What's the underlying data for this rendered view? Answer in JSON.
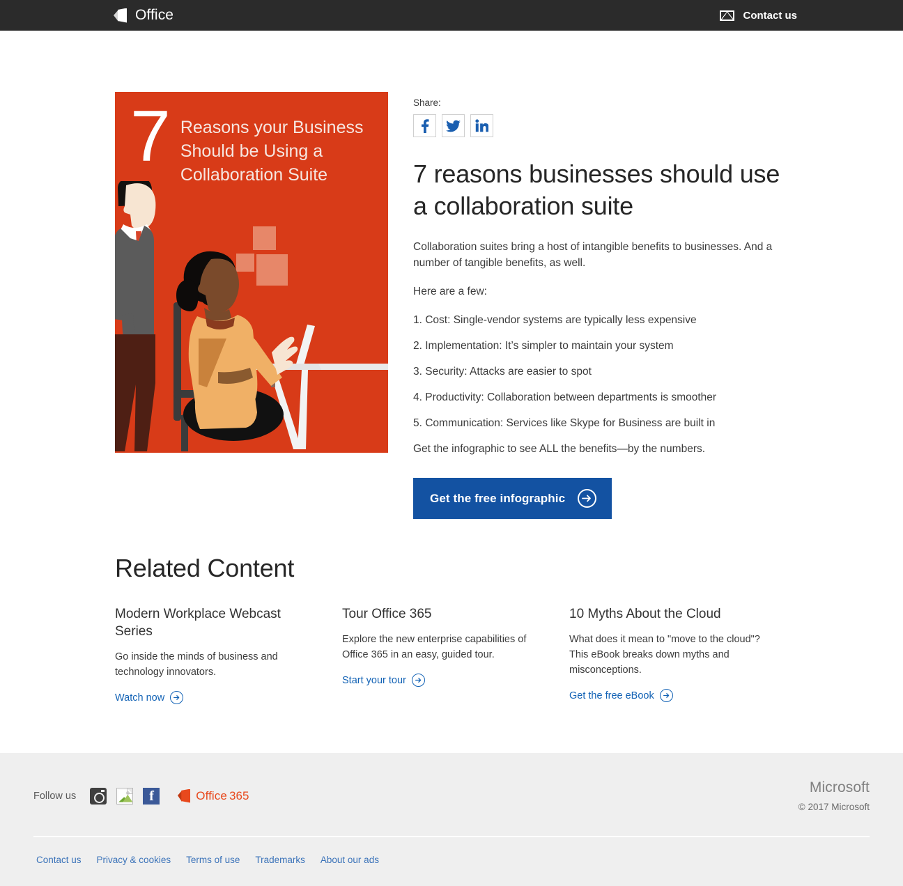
{
  "topnav": {
    "brand": "Office",
    "brand_icon": "office-logo-icon",
    "contact_label": "Contact us",
    "contact_icon": "envelope-icon",
    "background": "#2b2b2b"
  },
  "cover": {
    "number": "7",
    "lines": [
      "Reasons your Business",
      "Should be Using a",
      "Collaboration Suite"
    ],
    "background": "#d83b18",
    "illustration": "two-coworkers-at-desk-illustration"
  },
  "share": {
    "label": "Share:",
    "buttons": [
      {
        "name": "facebook",
        "glyph": "f",
        "color": "#1b5fb0"
      },
      {
        "name": "twitter",
        "glyph": "bird",
        "color": "#1b5fb0"
      },
      {
        "name": "linkedin",
        "glyph": "in",
        "color": "#1b5fb0"
      }
    ]
  },
  "article": {
    "headline": "7 reasons businesses should use a collaboration suite",
    "intro": "Collaboration suites bring a host of intangible benefits to businesses. And a number of tangible benefits, as well.",
    "lead_in": "Here are a few:",
    "reasons": [
      "1. Cost: Single-vendor systems are typically less expensive",
      "2. Implementation: It’s simpler to maintain your system",
      "3. Security: Attacks are easier to spot",
      "4. Productivity: Collaboration between departments is smoother",
      "5. Communication: Services like Skype for Business are built in"
    ],
    "closing": "Get the infographic to see ALL the benefits—by the numbers.",
    "cta_label": "Get the free infographic",
    "cta_color": "#1352a2"
  },
  "related": {
    "title": "Related Content",
    "cards": [
      {
        "title": "Modern Workplace Webcast Series",
        "description": "Go inside the minds of business and technology innovators.",
        "link_label": "Watch now"
      },
      {
        "title": "Tour Office 365",
        "description": "Explore the new enterprise capabilities of Office 365 in an easy, guided tour.",
        "link_label": "Start your tour"
      },
      {
        "title": "10 Myths About the Cloud",
        "description": "What does it mean to \"move to the cloud\"? This eBook breaks down myths and misconceptions.",
        "link_label": "Get the free eBook"
      }
    ]
  },
  "footer": {
    "follow_label": "Follow us",
    "social": [
      {
        "name": "instagram-icon"
      },
      {
        "name": "broken-image-icon"
      },
      {
        "name": "facebook-icon"
      }
    ],
    "office365_brand": "Office",
    "office365_number": "365",
    "microsoft_word": "Microsoft",
    "copyright": "© 2017 Microsoft",
    "links": [
      "Contact us",
      "Privacy & cookies",
      "Terms of use",
      "Trademarks",
      "About our ads"
    ],
    "background": "#efefef"
  }
}
